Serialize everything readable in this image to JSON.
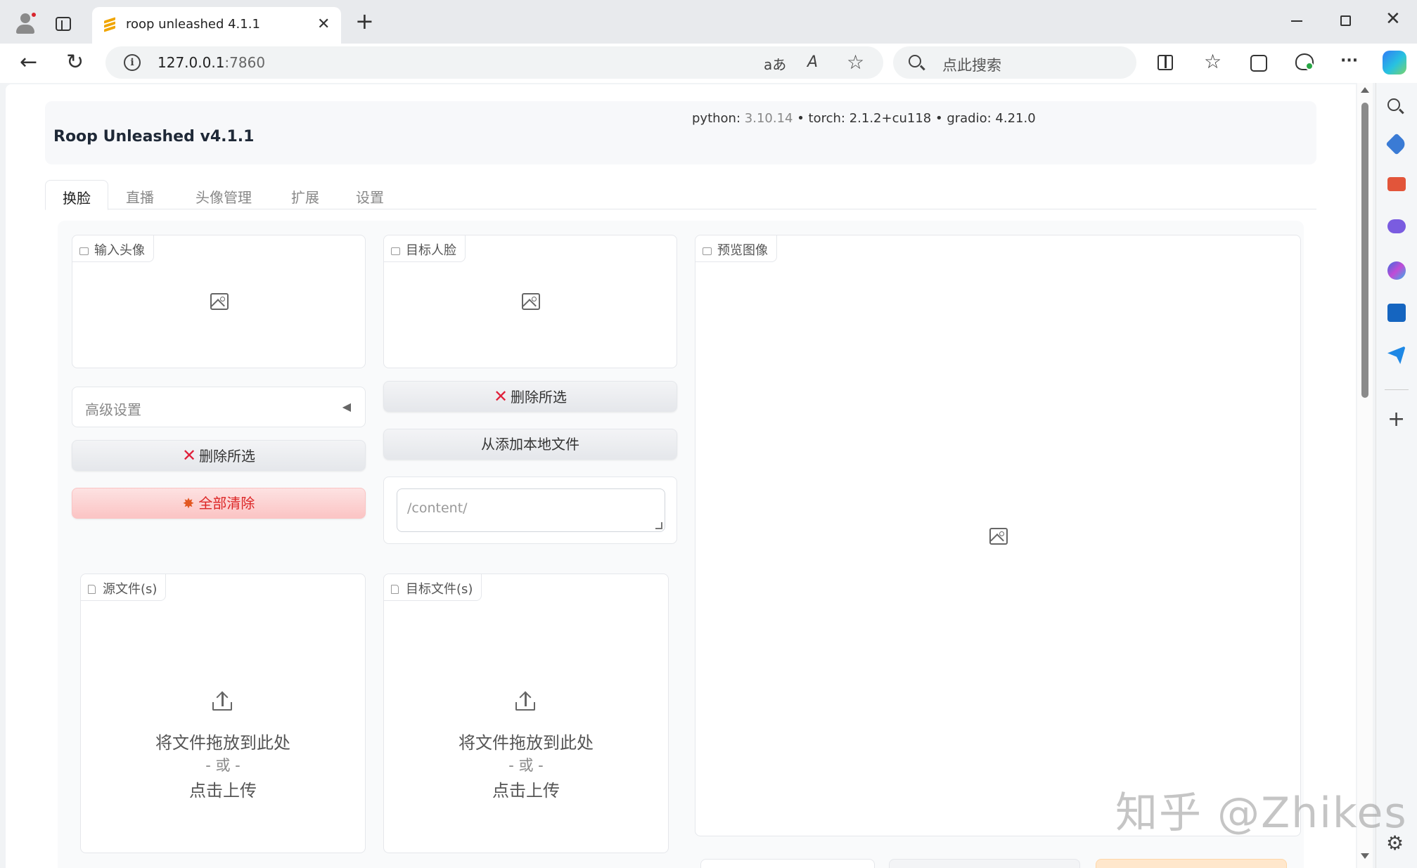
{
  "browser": {
    "tab_title": "roop unleashed 4.1.1",
    "url_host": "127.0.0.1",
    "url_port": ":7860",
    "search_placeholder": "点此搜索",
    "translate_icon_text": "aあ",
    "read_aloud_icon_text": "A",
    "close_glyph": "✕",
    "new_tab_glyph": "+",
    "back_glyph": "←",
    "refresh_glyph": "↻",
    "star_glyph": "☆",
    "more_glyph": "···",
    "sidebar_add_glyph": "+",
    "settings_glyph": "⚙"
  },
  "app": {
    "title": "Roop Unleashed v4.1.1",
    "python_label": "python: ",
    "python_version": "3.10.14",
    "torch_info": " • torch: 2.1.2+cu118 • gradio: 4.21.0"
  },
  "tabs": [
    {
      "label": "换脸"
    },
    {
      "label": "直播"
    },
    {
      "label": "头像管理"
    },
    {
      "label": "扩展"
    },
    {
      "label": "设置"
    }
  ],
  "panels": {
    "input_face_label": "输入头像",
    "target_face_label": "目标人脸",
    "preview_label": "预览图像",
    "advanced_settings": "高级设置",
    "accordion_arrow": "◀",
    "delete_selected_left": "删除所选",
    "delete_selected_right": "删除所选",
    "clear_all": "全部清除",
    "add_local_files": "从添加本地文件",
    "path_placeholder": "/content/",
    "source_files_label": "源文件(s)",
    "target_files_label": "目标文件(s)",
    "drop_here": "将文件拖放到此处",
    "or": "- 或 -",
    "click_upload": "点击上传"
  },
  "watermark": "知乎 @Zhikes",
  "colors": {
    "danger": "#dc2626",
    "danger_bg": "#fbc4c4",
    "x_mark": "#e0203a",
    "brand_favicon": "#f0a500"
  }
}
